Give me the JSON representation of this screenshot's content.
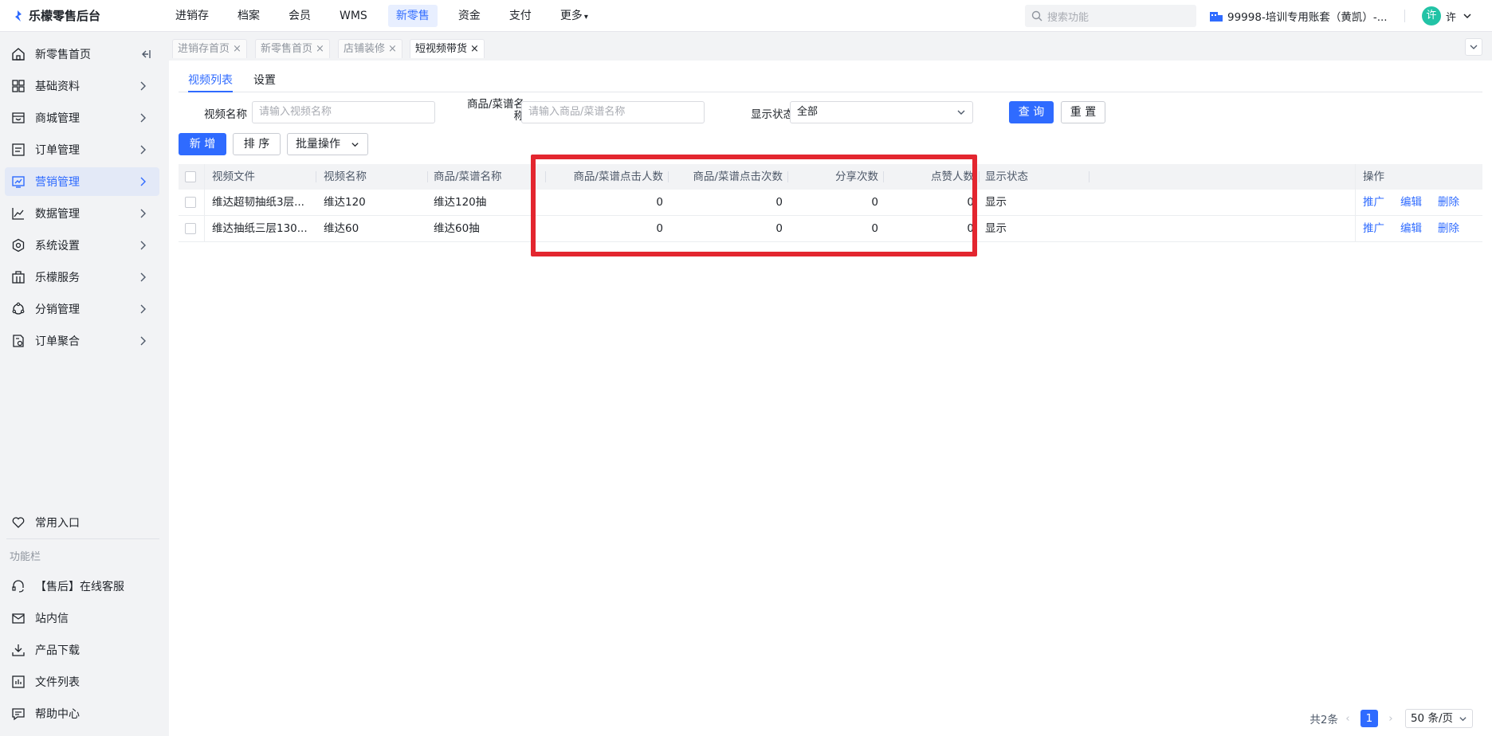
{
  "app": {
    "logo_text": "乐檬零售后台"
  },
  "topnav": [
    {
      "label": "进销存",
      "active": false
    },
    {
      "label": "档案",
      "active": false
    },
    {
      "label": "会员",
      "active": false
    },
    {
      "label": "WMS",
      "active": false
    },
    {
      "label": "新零售",
      "active": true
    },
    {
      "label": "资金",
      "active": false
    },
    {
      "label": "支付",
      "active": false
    },
    {
      "label": "更多",
      "active": false
    }
  ],
  "search": {
    "placeholder": "搜索功能"
  },
  "account": {
    "label": "99998-培训专用账套（黄凯）-..."
  },
  "user": {
    "avatar_char": "许",
    "name": "许"
  },
  "sidebar": {
    "items": [
      {
        "label": "新零售首页",
        "icon": "home-icon"
      },
      {
        "label": "基础资料",
        "icon": "grid-icon"
      },
      {
        "label": "商城管理",
        "icon": "store-icon"
      },
      {
        "label": "订单管理",
        "icon": "order-icon"
      },
      {
        "label": "营销管理",
        "icon": "marketing-icon",
        "active": true
      },
      {
        "label": "数据管理",
        "icon": "chart-icon"
      },
      {
        "label": "系统设置",
        "icon": "settings-icon"
      },
      {
        "label": "乐檬服务",
        "icon": "service-icon"
      },
      {
        "label": "分销管理",
        "icon": "distribution-icon"
      },
      {
        "label": "订单聚合",
        "icon": "aggregate-icon"
      }
    ],
    "favorites_label": "常用入口",
    "function_caption": "功能栏",
    "bottom_items": [
      {
        "label": "【售后】在线客服",
        "icon": "headset-icon"
      },
      {
        "label": "站内信",
        "icon": "mail-icon"
      },
      {
        "label": "产品下载",
        "icon": "download-icon"
      },
      {
        "label": "文件列表",
        "icon": "file-list-icon"
      },
      {
        "label": "帮助中心",
        "icon": "help-icon"
      }
    ]
  },
  "page_tabs": [
    {
      "label": "进销存首页",
      "active": false
    },
    {
      "label": "新零售首页",
      "active": false
    },
    {
      "label": "店铺装修",
      "active": false
    },
    {
      "label": "短视频带货",
      "active": true
    }
  ],
  "sub_tabs": [
    {
      "label": "视频列表",
      "active": true
    },
    {
      "label": "设置",
      "active": false
    }
  ],
  "filters": {
    "video_name_label": "视频名称",
    "video_name_placeholder": "请输入视频名称",
    "product_label_line1": "商品/菜谱名",
    "product_label_line2": "称",
    "product_placeholder": "请输入商品/菜谱名称",
    "status_label": "显示状态",
    "status_value": "全部",
    "query_button": "查 询",
    "reset_button": "重 置"
  },
  "toolbar": {
    "add_button": "新 增",
    "sort_button": "排 序",
    "batch_button": "批量操作"
  },
  "table": {
    "headers": [
      "视频文件",
      "视频名称",
      "商品/菜谱名称",
      "商品/菜谱点击人数",
      "商品/菜谱点击次数",
      "分享次数",
      "点赞人数",
      "显示状态",
      "操作"
    ],
    "rows": [
      {
        "file": "维达超韧抽纸3层...",
        "name": "维达120",
        "product": "维达120抽",
        "click_users": "0",
        "click_count": "0",
        "shares": "0",
        "likes": "0",
        "status": "显示"
      },
      {
        "file": "维达抽纸三层130...",
        "name": "维达60",
        "product": "维达60抽",
        "click_users": "0",
        "click_count": "0",
        "shares": "0",
        "likes": "0",
        "status": "显示"
      }
    ],
    "actions": [
      "推广",
      "编辑",
      "删除"
    ]
  },
  "pagination": {
    "total": "共2条",
    "current_page": "1",
    "page_size": "50 条/页"
  },
  "colors": {
    "primary": "#2f6bff",
    "highlight_box": "#e3262f",
    "avatar": "#22c3a6"
  }
}
